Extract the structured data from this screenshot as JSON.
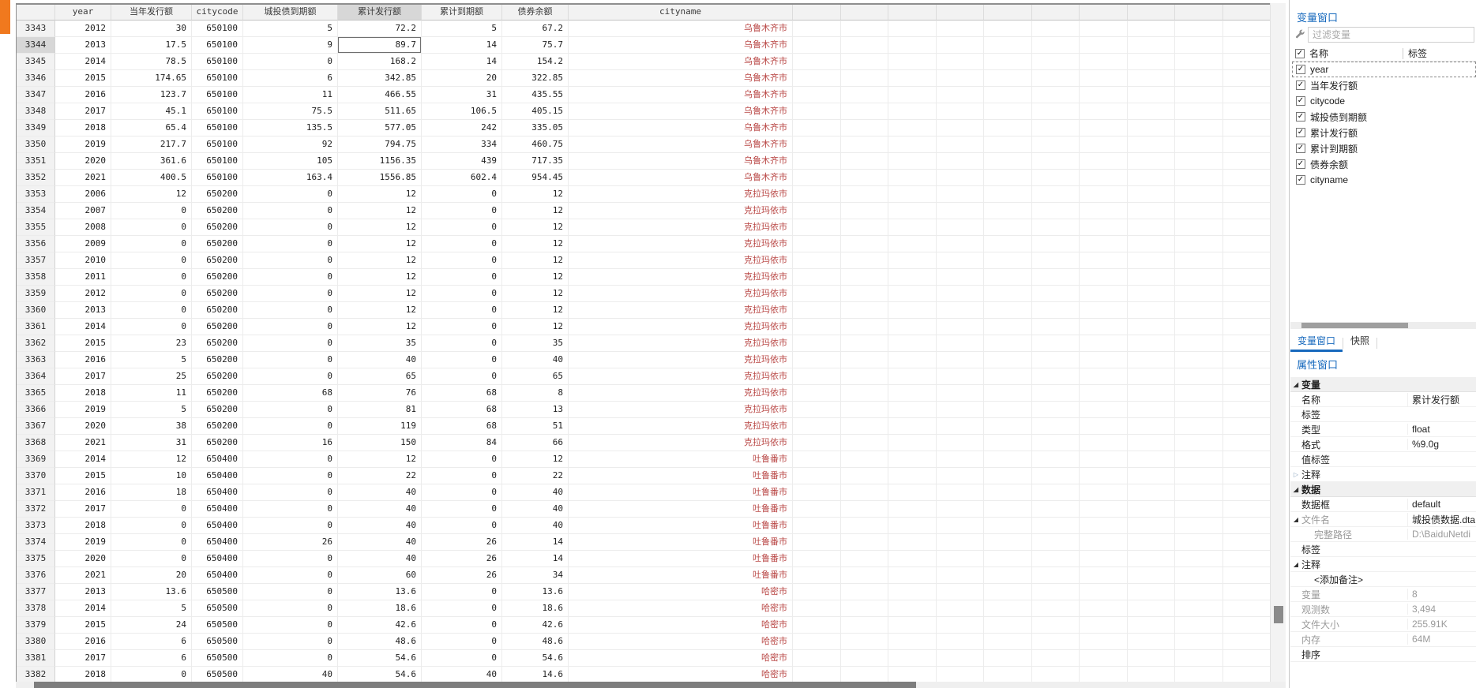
{
  "colors": {
    "accent_blue": "#1769bd",
    "string_red": "#b94745",
    "orange_fragment": "#F0791E",
    "header_gray": "#f2f2f2",
    "selection_gray": "#d7d7d7"
  },
  "grid": {
    "columns": [
      "",
      "year",
      "当年发行额",
      "citycode",
      "城投债到期额",
      "累计发行额",
      "累计到期额",
      "债券余额",
      "cityname"
    ],
    "selection": {
      "row": "3344",
      "column": "累计发行额",
      "value": "89.7",
      "row_index": 1,
      "col_index": 5
    },
    "rows": [
      [
        "3343",
        "2012",
        "30",
        "650100",
        "5",
        "72.2",
        "5",
        "67.2",
        "乌鲁木齐市"
      ],
      [
        "3344",
        "2013",
        "17.5",
        "650100",
        "9",
        "89.7",
        "14",
        "75.7",
        "乌鲁木齐市"
      ],
      [
        "3345",
        "2014",
        "78.5",
        "650100",
        "0",
        "168.2",
        "14",
        "154.2",
        "乌鲁木齐市"
      ],
      [
        "3346",
        "2015",
        "174.65",
        "650100",
        "6",
        "342.85",
        "20",
        "322.85",
        "乌鲁木齐市"
      ],
      [
        "3347",
        "2016",
        "123.7",
        "650100",
        "11",
        "466.55",
        "31",
        "435.55",
        "乌鲁木齐市"
      ],
      [
        "3348",
        "2017",
        "45.1",
        "650100",
        "75.5",
        "511.65",
        "106.5",
        "405.15",
        "乌鲁木齐市"
      ],
      [
        "3349",
        "2018",
        "65.4",
        "650100",
        "135.5",
        "577.05",
        "242",
        "335.05",
        "乌鲁木齐市"
      ],
      [
        "3350",
        "2019",
        "217.7",
        "650100",
        "92",
        "794.75",
        "334",
        "460.75",
        "乌鲁木齐市"
      ],
      [
        "3351",
        "2020",
        "361.6",
        "650100",
        "105",
        "1156.35",
        "439",
        "717.35",
        "乌鲁木齐市"
      ],
      [
        "3352",
        "2021",
        "400.5",
        "650100",
        "163.4",
        "1556.85",
        "602.4",
        "954.45",
        "乌鲁木齐市"
      ],
      [
        "3353",
        "2006",
        "12",
        "650200",
        "0",
        "12",
        "0",
        "12",
        "克拉玛依市"
      ],
      [
        "3354",
        "2007",
        "0",
        "650200",
        "0",
        "12",
        "0",
        "12",
        "克拉玛依市"
      ],
      [
        "3355",
        "2008",
        "0",
        "650200",
        "0",
        "12",
        "0",
        "12",
        "克拉玛依市"
      ],
      [
        "3356",
        "2009",
        "0",
        "650200",
        "0",
        "12",
        "0",
        "12",
        "克拉玛依市"
      ],
      [
        "3357",
        "2010",
        "0",
        "650200",
        "0",
        "12",
        "0",
        "12",
        "克拉玛依市"
      ],
      [
        "3358",
        "2011",
        "0",
        "650200",
        "0",
        "12",
        "0",
        "12",
        "克拉玛依市"
      ],
      [
        "3359",
        "2012",
        "0",
        "650200",
        "0",
        "12",
        "0",
        "12",
        "克拉玛依市"
      ],
      [
        "3360",
        "2013",
        "0",
        "650200",
        "0",
        "12",
        "0",
        "12",
        "克拉玛依市"
      ],
      [
        "3361",
        "2014",
        "0",
        "650200",
        "0",
        "12",
        "0",
        "12",
        "克拉玛依市"
      ],
      [
        "3362",
        "2015",
        "23",
        "650200",
        "0",
        "35",
        "0",
        "35",
        "克拉玛依市"
      ],
      [
        "3363",
        "2016",
        "5",
        "650200",
        "0",
        "40",
        "0",
        "40",
        "克拉玛依市"
      ],
      [
        "3364",
        "2017",
        "25",
        "650200",
        "0",
        "65",
        "0",
        "65",
        "克拉玛依市"
      ],
      [
        "3365",
        "2018",
        "11",
        "650200",
        "68",
        "76",
        "68",
        "8",
        "克拉玛依市"
      ],
      [
        "3366",
        "2019",
        "5",
        "650200",
        "0",
        "81",
        "68",
        "13",
        "克拉玛依市"
      ],
      [
        "3367",
        "2020",
        "38",
        "650200",
        "0",
        "119",
        "68",
        "51",
        "克拉玛依市"
      ],
      [
        "3368",
        "2021",
        "31",
        "650200",
        "16",
        "150",
        "84",
        "66",
        "克拉玛依市"
      ],
      [
        "3369",
        "2014",
        "12",
        "650400",
        "0",
        "12",
        "0",
        "12",
        "吐鲁番市"
      ],
      [
        "3370",
        "2015",
        "10",
        "650400",
        "0",
        "22",
        "0",
        "22",
        "吐鲁番市"
      ],
      [
        "3371",
        "2016",
        "18",
        "650400",
        "0",
        "40",
        "0",
        "40",
        "吐鲁番市"
      ],
      [
        "3372",
        "2017",
        "0",
        "650400",
        "0",
        "40",
        "0",
        "40",
        "吐鲁番市"
      ],
      [
        "3373",
        "2018",
        "0",
        "650400",
        "0",
        "40",
        "0",
        "40",
        "吐鲁番市"
      ],
      [
        "3374",
        "2019",
        "0",
        "650400",
        "26",
        "40",
        "26",
        "14",
        "吐鲁番市"
      ],
      [
        "3375",
        "2020",
        "0",
        "650400",
        "0",
        "40",
        "26",
        "14",
        "吐鲁番市"
      ],
      [
        "3376",
        "2021",
        "20",
        "650400",
        "0",
        "60",
        "26",
        "34",
        "吐鲁番市"
      ],
      [
        "3377",
        "2013",
        "13.6",
        "650500",
        "0",
        "13.6",
        "0",
        "13.6",
        "哈密市"
      ],
      [
        "3378",
        "2014",
        "5",
        "650500",
        "0",
        "18.6",
        "0",
        "18.6",
        "哈密市"
      ],
      [
        "3379",
        "2015",
        "24",
        "650500",
        "0",
        "42.6",
        "0",
        "42.6",
        "哈密市"
      ],
      [
        "3380",
        "2016",
        "6",
        "650500",
        "0",
        "48.6",
        "0",
        "48.6",
        "哈密市"
      ],
      [
        "3381",
        "2017",
        "6",
        "650500",
        "0",
        "54.6",
        "0",
        "54.6",
        "哈密市"
      ],
      [
        "3382",
        "2018",
        "0",
        "650500",
        "40",
        "54.6",
        "40",
        "14.6",
        "哈密市"
      ]
    ]
  },
  "variables_window": {
    "title": "变量窗口",
    "filter_placeholder": "过滤变量",
    "col_name": "名称",
    "col_label": "标签",
    "focused_item": "year",
    "items": [
      {
        "name": "year",
        "checked": true
      },
      {
        "name": "当年发行额",
        "checked": true
      },
      {
        "name": "citycode",
        "checked": true
      },
      {
        "name": "城投债到期额",
        "checked": true
      },
      {
        "name": "累计发行额",
        "checked": true
      },
      {
        "name": "累计到期额",
        "checked": true
      },
      {
        "name": "债券余额",
        "checked": true
      },
      {
        "name": "cityname",
        "checked": true
      }
    ]
  },
  "tabs": [
    {
      "label": "变量窗口",
      "active": true
    },
    {
      "label": "快照",
      "active": false
    }
  ],
  "properties_window": {
    "title": "属性窗口",
    "sections": [
      {
        "name": "变量",
        "rows": [
          {
            "label": "名称",
            "value": "累计发行额"
          },
          {
            "label": "标签",
            "value": ""
          },
          {
            "label": "类型",
            "value": "float"
          },
          {
            "label": "格式",
            "value": "%9.0g"
          },
          {
            "label": "值标签",
            "value": ""
          },
          {
            "label": "注释",
            "value": "",
            "collapsed": true
          }
        ]
      },
      {
        "name": "数据",
        "rows": [
          {
            "label": "数据框",
            "value": "default"
          },
          {
            "label": "文件名",
            "value": "城投债数据.dta",
            "expanded": true,
            "label_muted": true
          },
          {
            "label": "完整路径",
            "value": "D:\\BaiduNetdi",
            "child": true,
            "muted": true
          },
          {
            "label": "标签",
            "value": ""
          },
          {
            "label": "注释",
            "value": "",
            "expanded": true
          },
          {
            "label": "<添加备注>",
            "value": "",
            "child": true
          },
          {
            "label": "变量",
            "value": "8",
            "muted": true
          },
          {
            "label": "观测数",
            "value": "3,494",
            "muted": true
          },
          {
            "label": "文件大小",
            "value": "255.91K",
            "muted": true
          },
          {
            "label": "内存",
            "value": "64M",
            "muted": true
          },
          {
            "label": "排序",
            "value": ""
          }
        ]
      }
    ]
  }
}
